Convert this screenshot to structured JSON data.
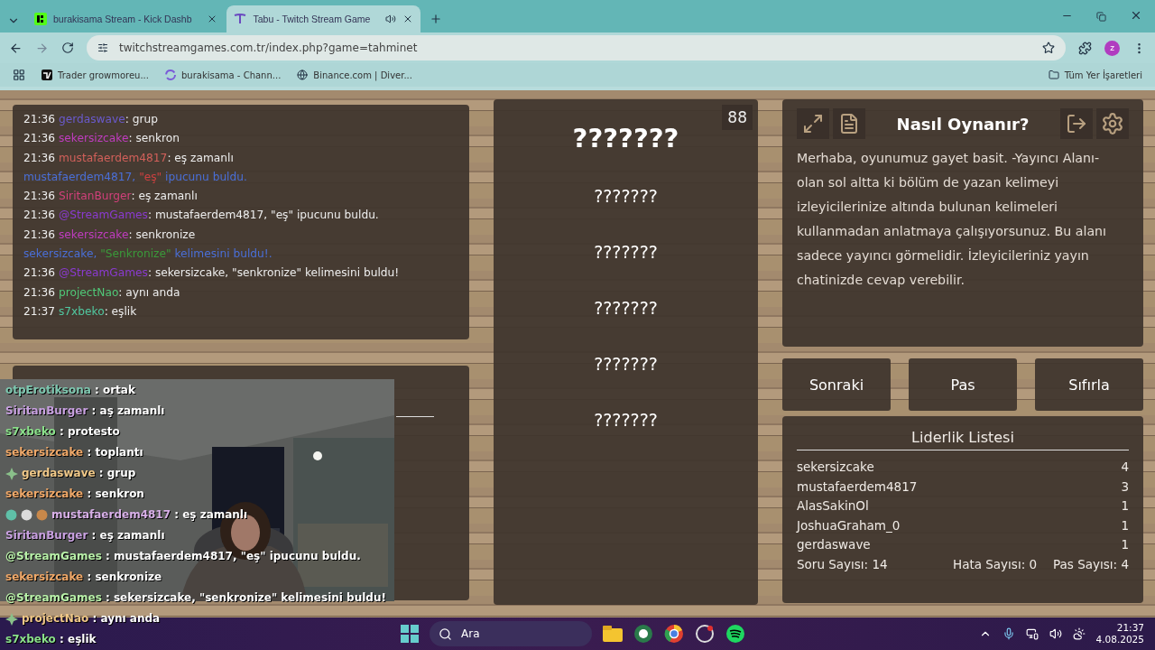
{
  "browser": {
    "tabs": [
      {
        "title": "burakisama Stream - Kick Dashb",
        "selected": false,
        "kind": "kick",
        "audio": false
      },
      {
        "title": "Tabu - Twitch Stream Game",
        "selected": true,
        "kind": "tabu",
        "audio": true
      }
    ],
    "address": "twitchstreamgames.com.tr/index.php?game=tahminet",
    "profile": "z",
    "bookmarks": [
      {
        "label": "Trader growmoreu...",
        "kind": "chart"
      },
      {
        "label": "burakisama - Chann...",
        "kind": "swirl"
      },
      {
        "label": "Binance.com | Diver...",
        "kind": "globe"
      }
    ],
    "all_bookmarks": "Tüm Yer İşaretleri"
  },
  "chat": {
    "messages": [
      {
        "kind": "message",
        "time": "21:36",
        "user": "gerdaswave",
        "color": "#6a5acd",
        "text": ": grup"
      },
      {
        "kind": "message",
        "time": "21:36",
        "user": "sekersizcake",
        "color": "#c03cc0",
        "text": ": senkron"
      },
      {
        "kind": "message",
        "time": "21:36",
        "user": "mustafaerdem4817",
        "color": "#d2605a",
        "text": ": eş zamanlı"
      },
      {
        "kind": "system",
        "parts": [
          {
            "text": "mustafaerdem4817, ",
            "color": "#4a6fd8"
          },
          {
            "text": "\"eş\"",
            "color": "#d04040"
          },
          {
            "text": " ipucunu buldu.",
            "color": "#4a6fd8"
          }
        ]
      },
      {
        "kind": "message",
        "time": "21:36",
        "user": "SiritanBurger",
        "color": "#d0407a",
        "text": ": eş zamanlı"
      },
      {
        "kind": "message",
        "time": "21:36",
        "user": "@StreamGames",
        "color": "#8a3ad0",
        "text": ": mustafaerdem4817, \"eş\" ipucunu buldu."
      },
      {
        "kind": "message",
        "time": "21:36",
        "user": "sekersizcake",
        "color": "#c03cc0",
        "text": ": senkronize"
      },
      {
        "kind": "system",
        "parts": [
          {
            "text": "sekersizcake, ",
            "color": "#4a6fd8"
          },
          {
            "text": "\"Senkronize\"",
            "color": "#3a9a3a"
          },
          {
            "text": " kelimesini buldu!.",
            "color": "#4a6fd8"
          }
        ]
      },
      {
        "kind": "message",
        "time": "21:36",
        "user": "@StreamGames",
        "color": "#8a3ad0",
        "text": ": sekersizcake, \"senkronize\" kelimesini buldu!"
      },
      {
        "kind": "message",
        "time": "21:36",
        "user": "projectNao",
        "color": "#50c878",
        "text": ": aynı anda"
      },
      {
        "kind": "message",
        "time": "21:37",
        "user": "s7xbeko",
        "color": "#50c8a0",
        "text": ": eşlik"
      }
    ]
  },
  "game": {
    "counter": "88",
    "title": "???????",
    "words": [
      "???????",
      "???????",
      "???????",
      "???????",
      "???????"
    ]
  },
  "how_to": {
    "title": "Nasıl Oynanır?",
    "text": "Merhaba, oyunumuz gayet basit. -Yayıncı Alanı- olan sol altta ki bölüm de yazan kelimeyi izleyicilerinize altında bulunan kelimeleri kullanmadan anlatmaya çalışıyorsunuz. Bu alanı sadece yayıncı görmelidir. İzleyicileriniz yayın chatinizde cevap verebilir."
  },
  "buttons": [
    "Sonraki",
    "Pas",
    "Sıfırla"
  ],
  "leaderboard": {
    "title": "Liderlik Listesi",
    "rows": [
      {
        "name": "sekersizcake",
        "score": "4"
      },
      {
        "name": "mustafaerdem4817",
        "score": "3"
      },
      {
        "name": "AlasSakinOl",
        "score": "1"
      },
      {
        "name": "JoshuaGraham_0",
        "score": "1"
      },
      {
        "name": "gerdaswave",
        "score": "1"
      }
    ],
    "stats": [
      "Soru Sayısı: 14",
      "Hata Sayısı: 0",
      "Pas Sayısı: 4"
    ]
  },
  "stream_overlay": {
    "chat": [
      {
        "user": "otpErotiksona",
        "color": "#7ec8b0",
        "text": " : ortak",
        "kind": "plain"
      },
      {
        "user": "SiritanBurger",
        "color": "#c8a0e0",
        "text": " : aş zamanlı",
        "kind": "plain"
      },
      {
        "user": "s7xbeko",
        "color": "#8ae08a",
        "text": " : protesto",
        "kind": "plain"
      },
      {
        "user": "sekersizcake",
        "color": "#f0a868",
        "text": " : toplantı",
        "kind": "plain"
      },
      {
        "user": "gerdaswave",
        "color": "#f0c888",
        "text": " : grup",
        "kind": "vip"
      },
      {
        "user": "sekersizcake",
        "color": "#f0a868",
        "text": " : senkron",
        "kind": "plain"
      },
      {
        "user": "mustafaerdem4817",
        "color": "#d8b0e8",
        "text": " : eş zamanlı",
        "kind": "sub"
      },
      {
        "user": "SiritanBurger",
        "color": "#c8a0e0",
        "text": " : eş zamanlı",
        "kind": "plain"
      },
      {
        "user": "@StreamGames",
        "color": "#b8f0a8",
        "text": " : mustafaerdem4817, \"eş\" ipucunu buldu.",
        "kind": "plain"
      },
      {
        "user": "sekersizcake",
        "color": "#f0a868",
        "text": " : senkronize",
        "kind": "plain"
      },
      {
        "user": "@StreamGames",
        "color": "#b8f0a8",
        "text": " : sekersizcake, \"senkronize\" kelimesini buldu!",
        "kind": "plain"
      },
      {
        "user": "projectNao",
        "color": "#f0c888",
        "text": " : aynı anda",
        "kind": "vip"
      },
      {
        "user": "s7xbeko",
        "color": "#8ae08a",
        "text": " : eşlik",
        "kind": "plain"
      }
    ]
  },
  "taskbar": {
    "search": "Ara",
    "time": "21:37",
    "date": "4.08.2025"
  }
}
